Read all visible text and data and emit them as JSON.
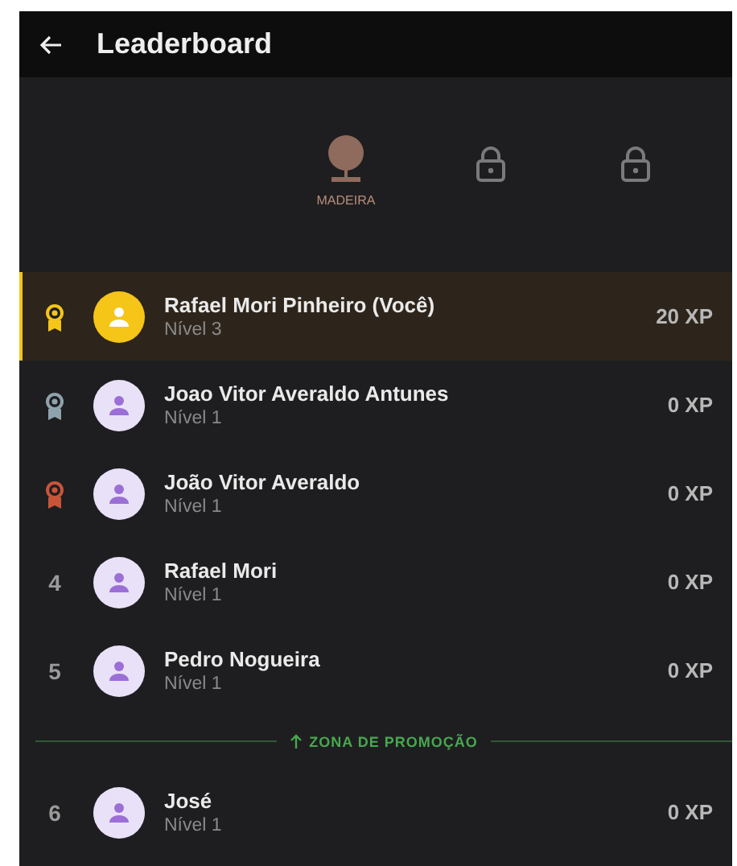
{
  "app_bar": {
    "title": "Leaderboard"
  },
  "tiers": [
    {
      "kind": "unlocked",
      "label": "MADEIRA",
      "selected": true
    },
    {
      "kind": "locked",
      "selected": false
    },
    {
      "kind": "locked",
      "selected": false
    }
  ],
  "entries": [
    {
      "kind": "player",
      "rank": {
        "kind": "medal",
        "color": "#f5c518"
      },
      "name": "Rafael Mori Pinheiro (Você)",
      "level_text": "Nível 3",
      "xp": "20 XP",
      "current": true
    },
    {
      "kind": "player",
      "rank": {
        "kind": "medal",
        "color": "#8fa3ad"
      },
      "name": "Joao Vitor Averaldo Antunes",
      "level_text": "Nível 1",
      "xp": "0 XP",
      "current": false
    },
    {
      "kind": "player",
      "rank": {
        "kind": "medal",
        "color": "#c8553a"
      },
      "name": "João Vitor Averaldo",
      "level_text": "Nível 1",
      "xp": "0 XP",
      "current": false
    },
    {
      "kind": "player",
      "rank": {
        "kind": "number",
        "text": "4"
      },
      "name": "Rafael Mori",
      "level_text": "Nível 1",
      "xp": "0 XP",
      "current": false
    },
    {
      "kind": "player",
      "rank": {
        "kind": "number",
        "text": "5"
      },
      "name": "Pedro Nogueira",
      "level_text": "Nível 1",
      "xp": "0 XP",
      "current": false
    },
    {
      "kind": "divider",
      "label": "ZONA DE PROMOÇÃO"
    },
    {
      "kind": "player",
      "rank": {
        "kind": "number",
        "text": "6"
      },
      "name": "José",
      "level_text": "Nível 1",
      "xp": "0 XP",
      "current": false
    }
  ]
}
